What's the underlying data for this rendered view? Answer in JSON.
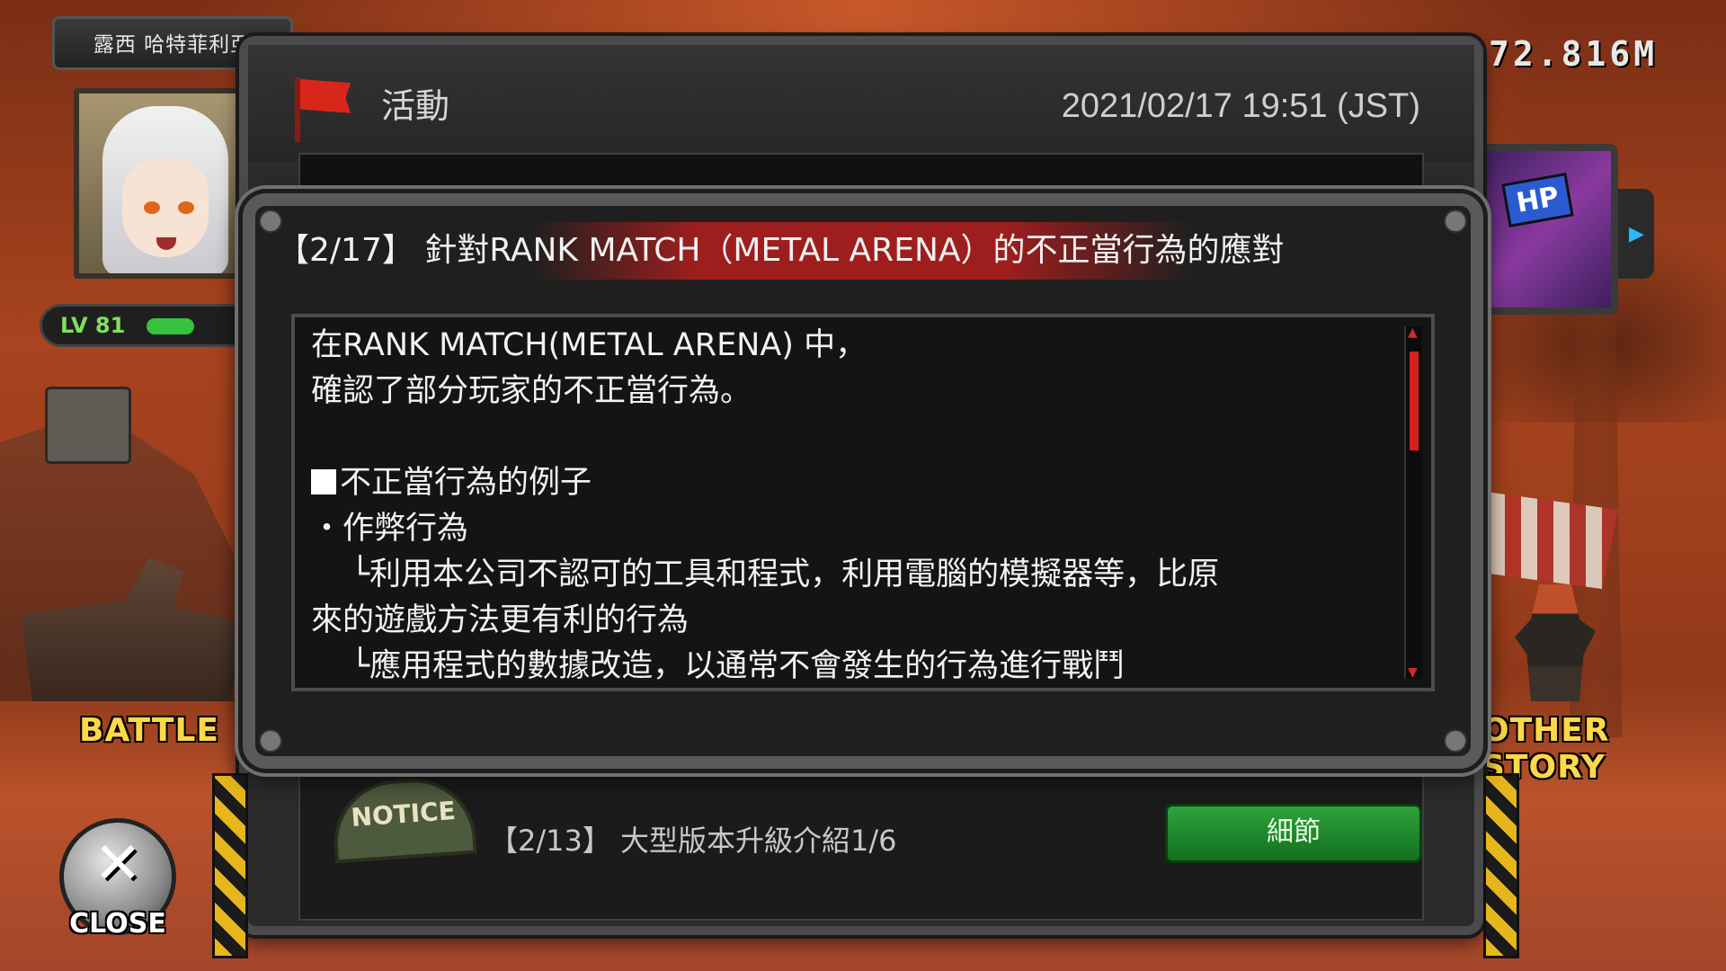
{
  "profile": {
    "name": "露西 哈特菲利亞",
    "level_label": "LV 81",
    "level_progress": 0.45
  },
  "currency": "72.816M",
  "side": {
    "battle_label": "BATTLE",
    "other_story_label": "OTHER STORY",
    "hp_badge": "HP",
    "close_label": "CLOSE"
  },
  "window": {
    "title": "活動",
    "timestamp": "2021/02/17 19:51 (JST)",
    "notice_badge": "NOTICE",
    "notice_title": "【2/13】 大型版本升級介紹1/6",
    "detail_button": "細節"
  },
  "popup": {
    "title": "【2/17】 針對RANK MATCH（METAL ARENA）的不正當行為的應對",
    "lines": {
      "l1": "在RANK MATCH(METAL ARENA) 中，",
      "l2": "確認了部分玩家的不正當行為。",
      "l3": "不正當行為的例子",
      "l4": "・作弊行為",
      "l5": "└利用本公司不認可的工具和程式，利用電腦的模擬器等，比原",
      "l6": "來的遊戲方法更有利的行為",
      "l7": "└應用程式的數據改造，以通常不會發生的行為進行戰鬥"
    }
  },
  "colors": {
    "accent_red": "#d8201c",
    "detail_green": "#2fa23c",
    "label_yellow": "#ffd84a",
    "level_green": "#36c23e"
  }
}
